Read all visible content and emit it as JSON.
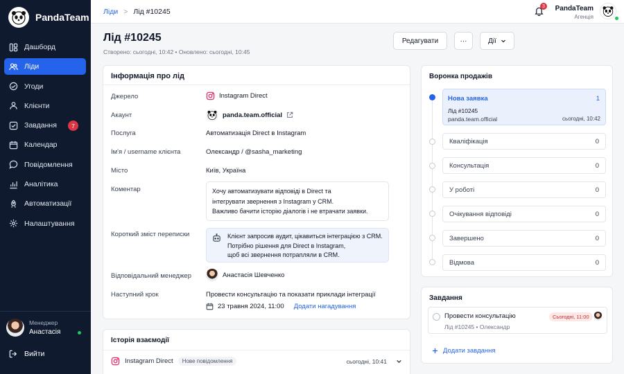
{
  "brand": {
    "name": "PandaTeam"
  },
  "sidebar": {
    "items": [
      {
        "label": "Дашборд",
        "icon": "dashboard-icon"
      },
      {
        "label": "Ліди",
        "icon": "users-icon",
        "active": true
      },
      {
        "label": "Угоди",
        "icon": "handshake-icon"
      },
      {
        "label": "Клієнти",
        "icon": "user-icon"
      },
      {
        "label": "Завдання",
        "icon": "checkbox-icon",
        "badge": "7"
      },
      {
        "label": "Календар",
        "icon": "calendar-icon"
      },
      {
        "label": "Повідомлення",
        "icon": "chat-icon"
      },
      {
        "label": "Аналітика",
        "icon": "chart-icon"
      },
      {
        "label": "Автоматизації",
        "icon": "automation-icon"
      },
      {
        "label": "Налаштування",
        "icon": "gear-icon"
      }
    ],
    "user": {
      "role": "Менеджер",
      "name": "Анастасія"
    },
    "logout_label": "Вийти"
  },
  "topbar": {
    "breadcrumb_root": "Ліди",
    "breadcrumb_sep": ">",
    "breadcrumb_current": "Лід #10245",
    "notifications_count": "3",
    "user_name": "PandaTeam",
    "user_role": "Агенція"
  },
  "header": {
    "title": "Лід #10245",
    "meta": "Створено: сьогодні, 10:42  •  Оновлено: сьогодні, 10:45",
    "edit_label": "Редагувати",
    "more_label": "···",
    "actions_label": "Дії"
  },
  "lead_info": {
    "title": "Інформація про лід",
    "source_label": "Джерело",
    "source_value": "Instagram Direct",
    "account_label": "Акаунт",
    "account_value": "panda.team.official",
    "service_label": "Послуга",
    "service_value": "Автоматизація Direct в Instagram",
    "client_label": "Ім'я / username клієнта",
    "client_value": "Олександр / @sasha_marketing",
    "city_label": "Місто",
    "city_value": "Київ, Україна",
    "comment_label": "Коментар",
    "comment_lines": [
      "Хочу автоматизувати відповіді в Direct та",
      "інтегрувати звернення з Instagram у CRM.",
      "Важливо бачити історію діалогів і не втрачати заявки."
    ],
    "summary_label": "Короткий зміст переписки",
    "summary_lines": [
      "Клієнт запросив аудит, цікавиться інтеграцією з CRM.",
      "Потрібно рішення для Direct в Instagram,",
      "щоб всі звернення потрапляли в CRM."
    ],
    "manager_label": "Відповідальний менеджер",
    "manager_value": "Анастасія Шевченко",
    "next_step_label": "Наступний крок",
    "next_step_value": "Провести консультацію та показати приклади інтеграції",
    "next_step_date": "23 травня 2024, 11:00",
    "reminder_link": "Додати нагадування"
  },
  "history": {
    "title": "Історія взаємодії",
    "item_channel": "Instagram Direct",
    "item_badge": "Нове повідомлення",
    "item_time": "сьогодні, 10:41"
  },
  "funnel": {
    "title": "Воронка продажів",
    "active": {
      "label": "Нова заявка",
      "count": "1",
      "lead": "Лід #10245",
      "account": "panda.team.official",
      "time": "сьогодні, 10:42"
    },
    "stages": [
      {
        "label": "Кваліфікація",
        "count": "0"
      },
      {
        "label": "Консультація",
        "count": "0"
      },
      {
        "label": "У роботі",
        "count": "0"
      },
      {
        "label": "Очікування відповіді",
        "count": "0"
      },
      {
        "label": "Завершено",
        "count": "0"
      },
      {
        "label": "Відмова",
        "count": "0"
      }
    ]
  },
  "tasks": {
    "title": "Завдання",
    "task_title": "Провести консультацію",
    "task_badge": "Сьогодні, 11:00",
    "task_meta": "Лід #10245  •  Олександр",
    "add_label": "Додати завдання"
  },
  "colors": {
    "accent": "#2563eb",
    "sidebar_bg": "#0f1a2e",
    "badge_red": "#dc3545",
    "instagram": "#e1306c"
  }
}
